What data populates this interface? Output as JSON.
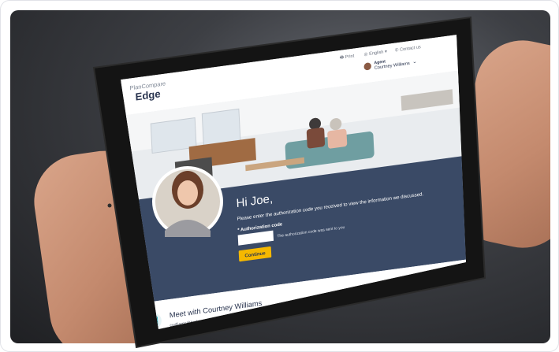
{
  "brand": {
    "line1": "PlanCompare",
    "line2": "Edge"
  },
  "topnav": {
    "print": "Print",
    "language": "English",
    "contact": "Contact us",
    "agent_role": "Agent",
    "agent_name": "Courtney Williams"
  },
  "hero": {
    "greeting": "Hi Joe,",
    "instruction": "Please enter the authorization code you received to view the information we discussed.",
    "code_label": "* Authorization code",
    "code_value": "",
    "code_hint": "The authorization code was sent to you",
    "continue_label": "Continue"
  },
  "meet": {
    "title": "Meet with Courtney Williams",
    "email": "cwilliams@brokeragency.com"
  },
  "colors": {
    "navy": "#3a4a66",
    "button": "#f5b800",
    "accent": "#2fa6b3"
  }
}
